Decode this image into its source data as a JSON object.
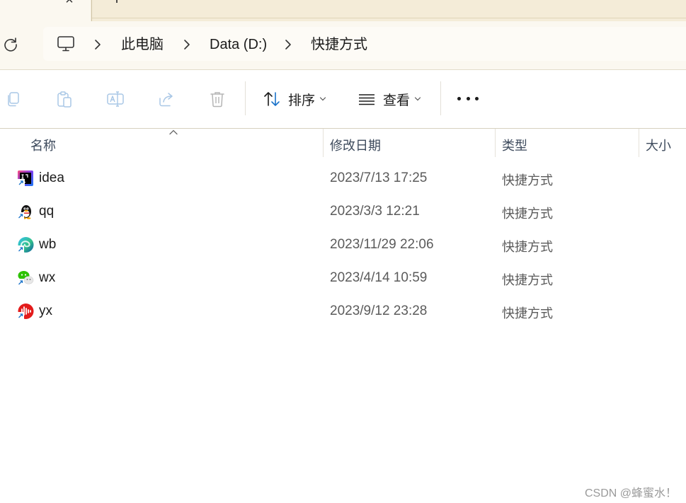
{
  "tabs": {
    "close_glyph": "×",
    "new_glyph": "+"
  },
  "address": {
    "crumbs": [
      "此电脑",
      "Data (D:)",
      "快捷方式"
    ]
  },
  "toolbar": {
    "icons": [
      "copy-icon",
      "paste-icon",
      "rename-icon",
      "share-icon",
      "delete-icon"
    ],
    "sort_label": "排序",
    "view_label": "查看",
    "accent": "#1a73c9"
  },
  "columns": {
    "name": "名称",
    "date": "修改日期",
    "type": "类型",
    "size": "大小"
  },
  "files": [
    {
      "name": "idea",
      "date": "2023/7/13 17:25",
      "type": "快捷方式",
      "icon": "intellij-idea-icon"
    },
    {
      "name": "qq",
      "date": "2023/3/3 12:21",
      "type": "快捷方式",
      "icon": "qq-penguin-icon"
    },
    {
      "name": "wb",
      "date": "2023/11/29 22:06",
      "type": "快捷方式",
      "icon": "edge-browser-icon"
    },
    {
      "name": "wx",
      "date": "2023/4/14 10:59",
      "type": "快捷方式",
      "icon": "wechat-icon"
    },
    {
      "name": "yx",
      "date": "2023/9/12 23:28",
      "type": "快捷方式",
      "icon": "netease-music-icon"
    }
  ],
  "watermark": "CSDN @蜂蜜水！"
}
